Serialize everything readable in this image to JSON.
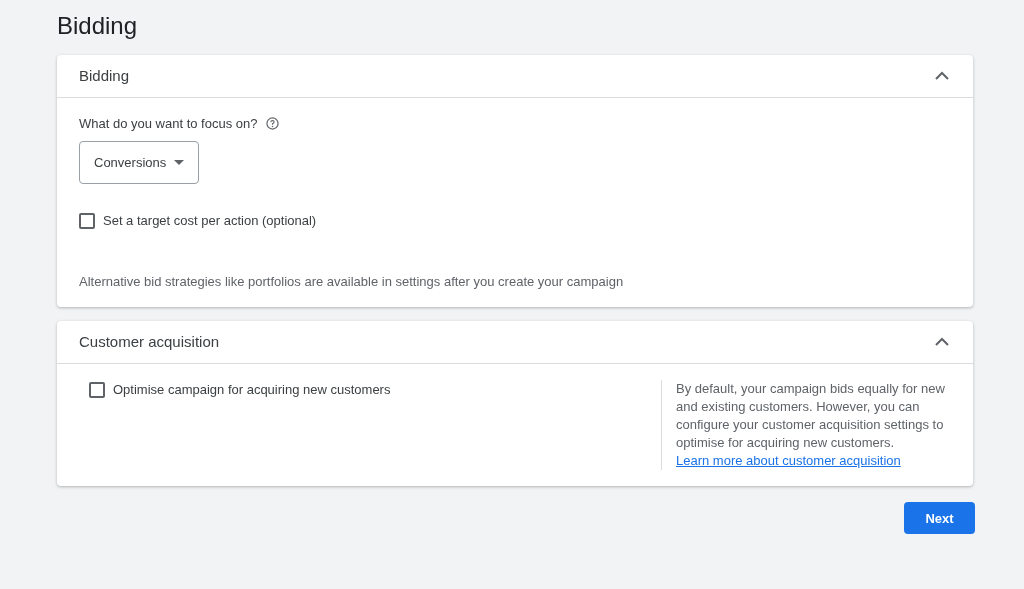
{
  "page_title": "Bidding",
  "sections": [
    {
      "kind": "bidding",
      "title": "Bidding",
      "expanded": true,
      "focus_label": "What do you want to focus on?",
      "focus_value": "Conversions",
      "checkbox": {
        "label": "Set a target cost per action (optional)",
        "checked": false
      },
      "note": "Alternative bid strategies like portfolios are available in settings after you create your campaign"
    },
    {
      "kind": "acquisition",
      "title": "Customer acquisition",
      "expanded": true,
      "checkbox": {
        "label": "Optimise campaign for acquiring new customers",
        "checked": false
      },
      "help_text": "By default, your campaign bids equally for new and existing customers. However, you can configure your customer acquisition settings to optimise for acquiring new customers.",
      "help_link": "Learn more about customer acquisition"
    }
  ],
  "next_button": "Next"
}
